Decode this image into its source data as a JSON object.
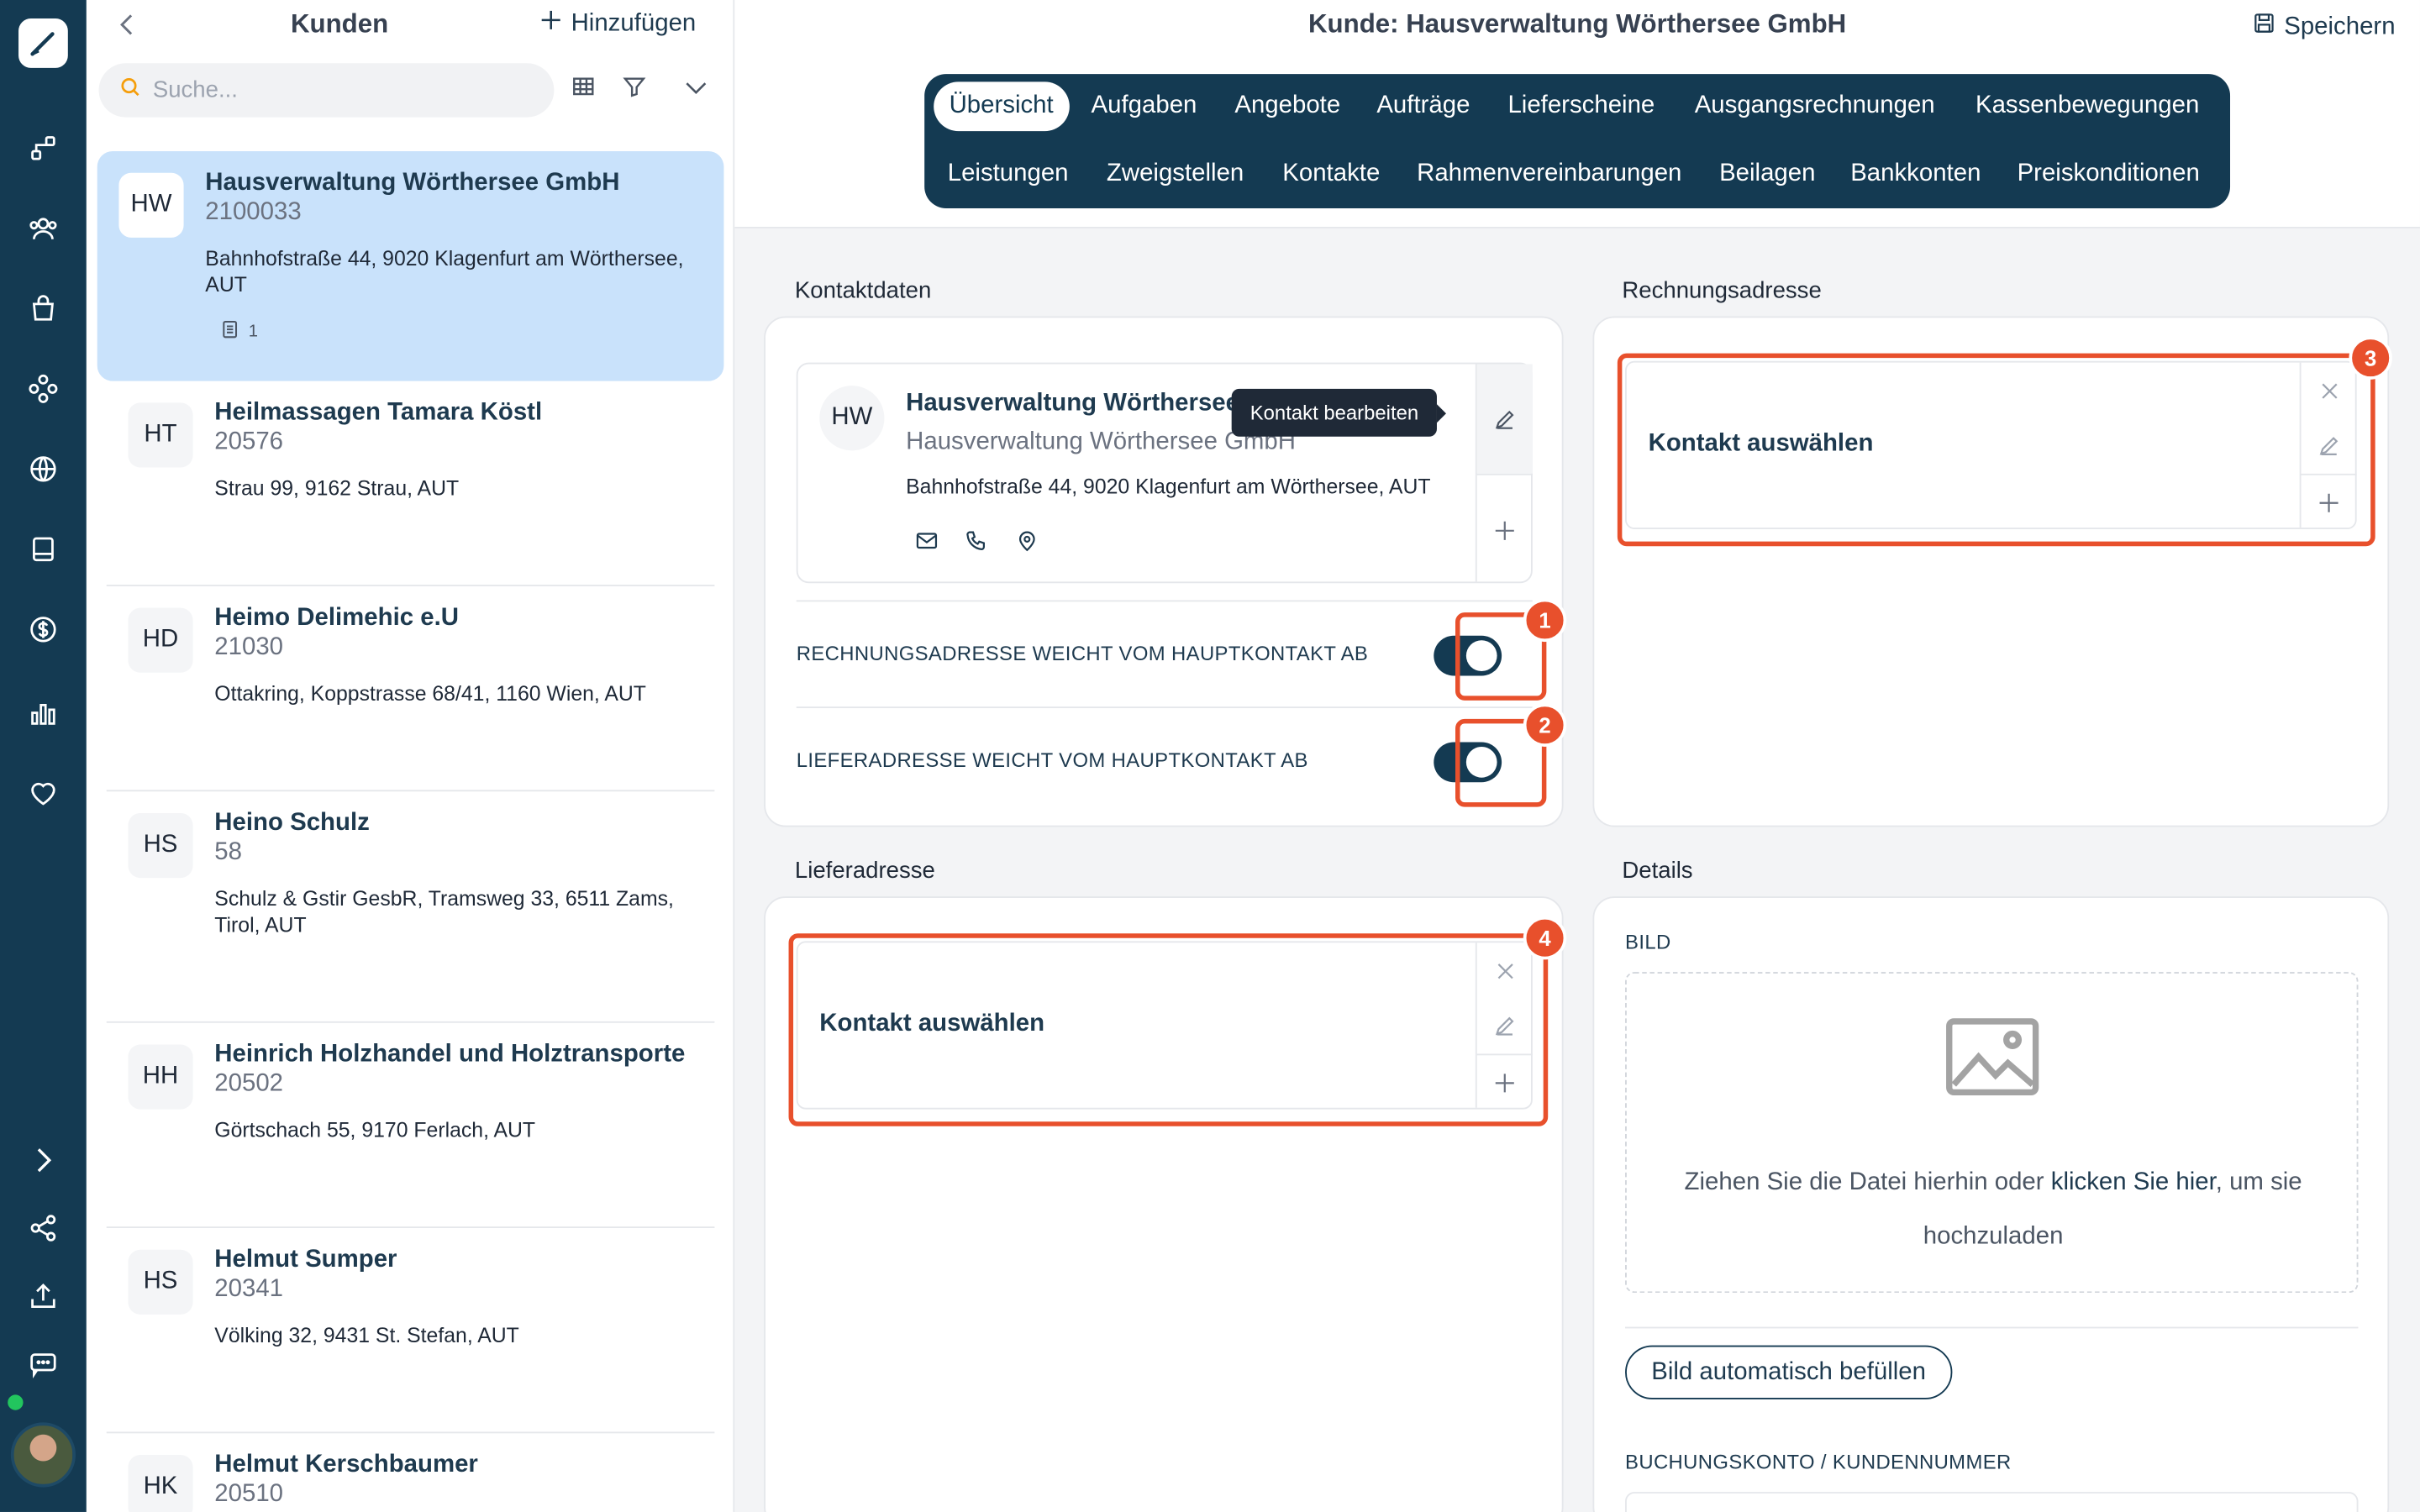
{
  "list": {
    "title": "Kunden",
    "add_label": "Hinzufügen",
    "search_placeholder": "Suche...",
    "customers": [
      {
        "initials": "HW",
        "name": "Hausverwaltung Wörthersee GmbH",
        "number": "2100033",
        "address": "Bahnhofstraße 44, 9020 Klagenfurt am Wörthersee, AUT",
        "badge": "1",
        "selected": true
      },
      {
        "initials": "HT",
        "name": "Heilmassagen Tamara Köstl",
        "number": "20576",
        "address": "Strau 99, 9162 Strau, AUT"
      },
      {
        "initials": "HD",
        "name": "Heimo Delimehic e.U",
        "number": "21030",
        "address": "Ottakring, Koppstrasse 68/41, 1160 Wien, AUT"
      },
      {
        "initials": "HS",
        "name": "Heino Schulz",
        "number": "58",
        "address": "Schulz & Gstir GesbR, Tramsweg 33, 6511 Zams, Tirol, AUT"
      },
      {
        "initials": "HH",
        "name": "Heinrich Holzhandel und Holztransporte",
        "number": "20502",
        "address": "Görtschach 55, 9170 Ferlach, AUT"
      },
      {
        "initials": "HS",
        "name": "Helmut Sumper",
        "number": "20341",
        "address": "Völking 32, 9431 St. Stefan, AUT"
      },
      {
        "initials": "HK",
        "name": "Helmut Kerschbaumer",
        "number": "20510",
        "address": ""
      }
    ]
  },
  "header": {
    "title": "Kunde: Hausverwaltung Wörthersee GmbH",
    "save_label": "Speichern"
  },
  "tabs": [
    "Übersicht",
    "Aufgaben",
    "Angebote",
    "Aufträge",
    "Lieferscheine",
    "Ausgangsrechnungen",
    "Kassenbewegungen",
    "Leistungen",
    "Zweigstellen",
    "Kontakte",
    "Rahmenvereinbarungen",
    "Beilagen",
    "Bankkonten",
    "Preiskonditionen"
  ],
  "kontaktdaten": {
    "title": "Kontaktdaten",
    "initials": "HW",
    "name": "Hausverwaltung Wörthersee GmbH",
    "subname": "Hausverwaltung Wörthersee GmbH",
    "address": "Bahnhofstraße 44, 9020 Klagenfurt am Wörthersee, AUT",
    "tooltip": "Kontakt bearbeiten",
    "toggle1_label": "RECHNUNGSADRESSE WEICHT VOM HAUPTKONTAKT AB",
    "toggle2_label": "LIEFERADRESSE WEICHT VOM HAUPTKONTAKT AB",
    "toggle1_on": true,
    "toggle2_on": true
  },
  "rechnungsadresse": {
    "title": "Rechnungsadresse",
    "pick_label": "Kontakt auswählen"
  },
  "lieferadresse": {
    "title": "Lieferadresse",
    "pick_label": "Kontakt auswählen"
  },
  "details": {
    "title": "Details",
    "bild_label": "BILD",
    "drop_text_1": "Ziehen Sie die Datei hierhin oder ",
    "drop_link": "klicken Sie hier",
    "drop_text_2": ", um sie hochzuladen",
    "auto_button": "Bild automatisch befüllen",
    "konto_label": "BUCHUNGSKONTO / KUNDENNUMMER"
  },
  "markers": [
    "1",
    "2",
    "3",
    "4"
  ],
  "colors": {
    "rail": "#143a52",
    "accent": "#e8502c",
    "selected": "#c9e2fb"
  }
}
